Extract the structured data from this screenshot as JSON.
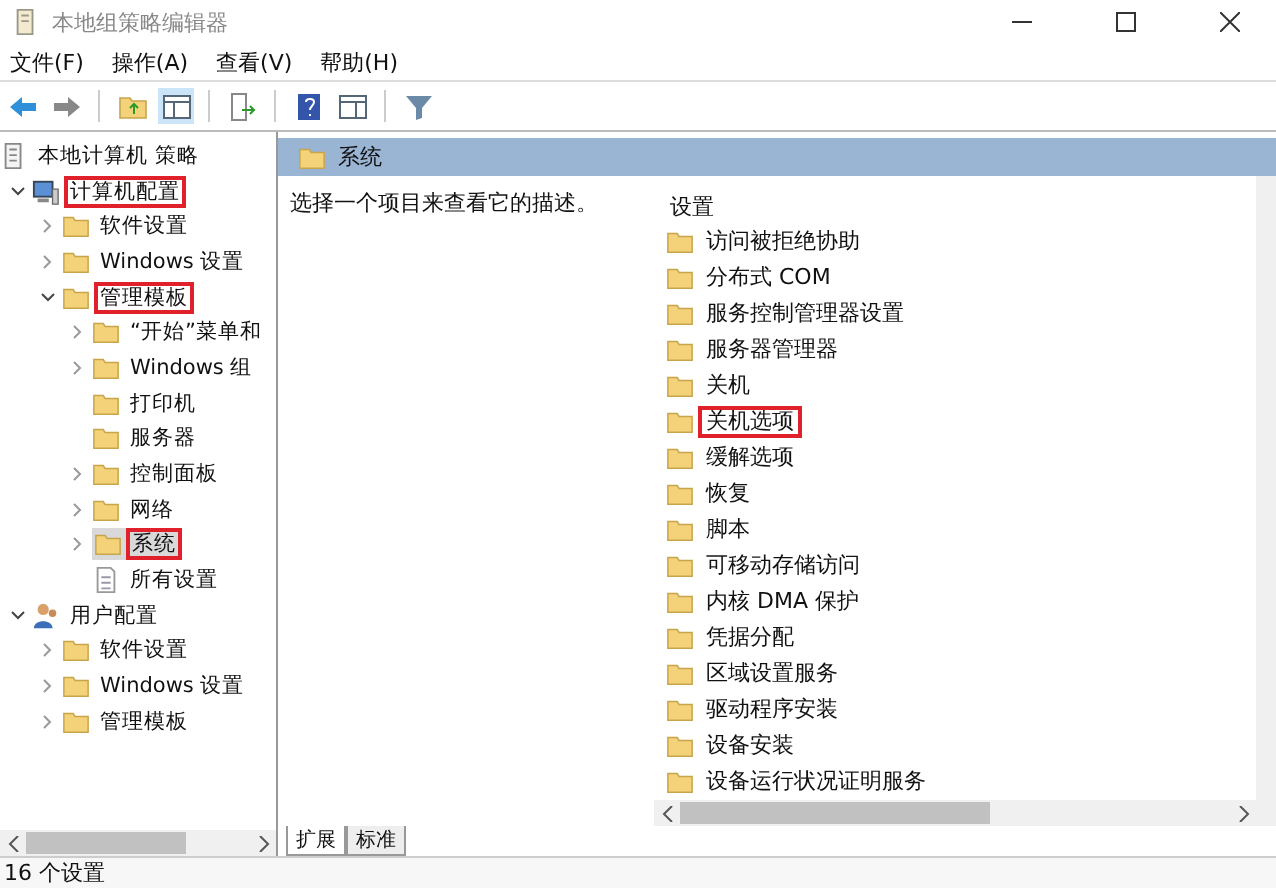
{
  "window": {
    "title": "本地组策略编辑器"
  },
  "menu": [
    "文件(F)",
    "操作(A)",
    "查看(V)",
    "帮助(H)"
  ],
  "tree": [
    {
      "label": "本地计算机 策略",
      "kind": "policy",
      "selected": false,
      "highlighted": false,
      "children": [
        {
          "label": "计算机配置",
          "kind": "computer",
          "expanded": true,
          "selected": false,
          "highlighted": true,
          "children": [
            {
              "label": "软件设置",
              "kind": "folder",
              "expanded": false,
              "selected": false,
              "highlighted": false
            },
            {
              "label": "Windows 设置",
              "kind": "folder",
              "expanded": false,
              "selected": false,
              "highlighted": false
            },
            {
              "label": "管理模板",
              "kind": "folder",
              "expanded": true,
              "selected": false,
              "highlighted": true,
              "children": [
                {
                  "label": "“开始”菜单和",
                  "kind": "folder",
                  "expanded": false,
                  "selected": false,
                  "highlighted": false
                },
                {
                  "label": "Windows 组",
                  "kind": "folder",
                  "expanded": false,
                  "selected": false,
                  "highlighted": false
                },
                {
                  "label": "打印机",
                  "kind": "folder",
                  "selected": false,
                  "highlighted": false
                },
                {
                  "label": "服务器",
                  "kind": "folder",
                  "selected": false,
                  "highlighted": false
                },
                {
                  "label": "控制面板",
                  "kind": "folder",
                  "expanded": false,
                  "selected": false,
                  "highlighted": false
                },
                {
                  "label": "网络",
                  "kind": "folder",
                  "expanded": false,
                  "selected": false,
                  "highlighted": false
                },
                {
                  "label": "系统",
                  "kind": "folder",
                  "expanded": false,
                  "selected": true,
                  "highlighted": true
                },
                {
                  "label": "所有设置",
                  "kind": "settings",
                  "selected": false,
                  "highlighted": false
                }
              ]
            }
          ]
        },
        {
          "label": "用户配置",
          "kind": "user",
          "expanded": true,
          "selected": false,
          "highlighted": false,
          "children": [
            {
              "label": "软件设置",
              "kind": "folder",
              "expanded": false,
              "selected": false,
              "highlighted": false
            },
            {
              "label": "Windows 设置",
              "kind": "folder",
              "expanded": false,
              "selected": false,
              "highlighted": false
            },
            {
              "label": "管理模板",
              "kind": "folder",
              "expanded": false,
              "selected": false,
              "highlighted": false
            }
          ]
        }
      ]
    }
  ],
  "details": {
    "header": "系统",
    "description": "选择一个项目来查看它的描述。",
    "column": "设置",
    "items": [
      {
        "label": "访问被拒绝协助",
        "highlighted": false
      },
      {
        "label": "分布式 COM",
        "highlighted": false
      },
      {
        "label": "服务控制管理器设置",
        "highlighted": false
      },
      {
        "label": "服务器管理器",
        "highlighted": false
      },
      {
        "label": "关机",
        "highlighted": false
      },
      {
        "label": "关机选项",
        "highlighted": true
      },
      {
        "label": "缓解选项",
        "highlighted": false
      },
      {
        "label": "恢复",
        "highlighted": false
      },
      {
        "label": "脚本",
        "highlighted": false
      },
      {
        "label": "可移动存储访问",
        "highlighted": false
      },
      {
        "label": "内核 DMA 保护",
        "highlighted": false
      },
      {
        "label": "凭据分配",
        "highlighted": false
      },
      {
        "label": "区域设置服务",
        "highlighted": false
      },
      {
        "label": "驱动程序安装",
        "highlighted": false
      },
      {
        "label": "设备安装",
        "highlighted": false
      },
      {
        "label": "设备运行状况证明服务",
        "highlighted": false
      }
    ],
    "tabs": [
      {
        "label": "扩展",
        "selected": true
      },
      {
        "label": "标准",
        "selected": false
      }
    ]
  },
  "status_bar": "16 个设置"
}
